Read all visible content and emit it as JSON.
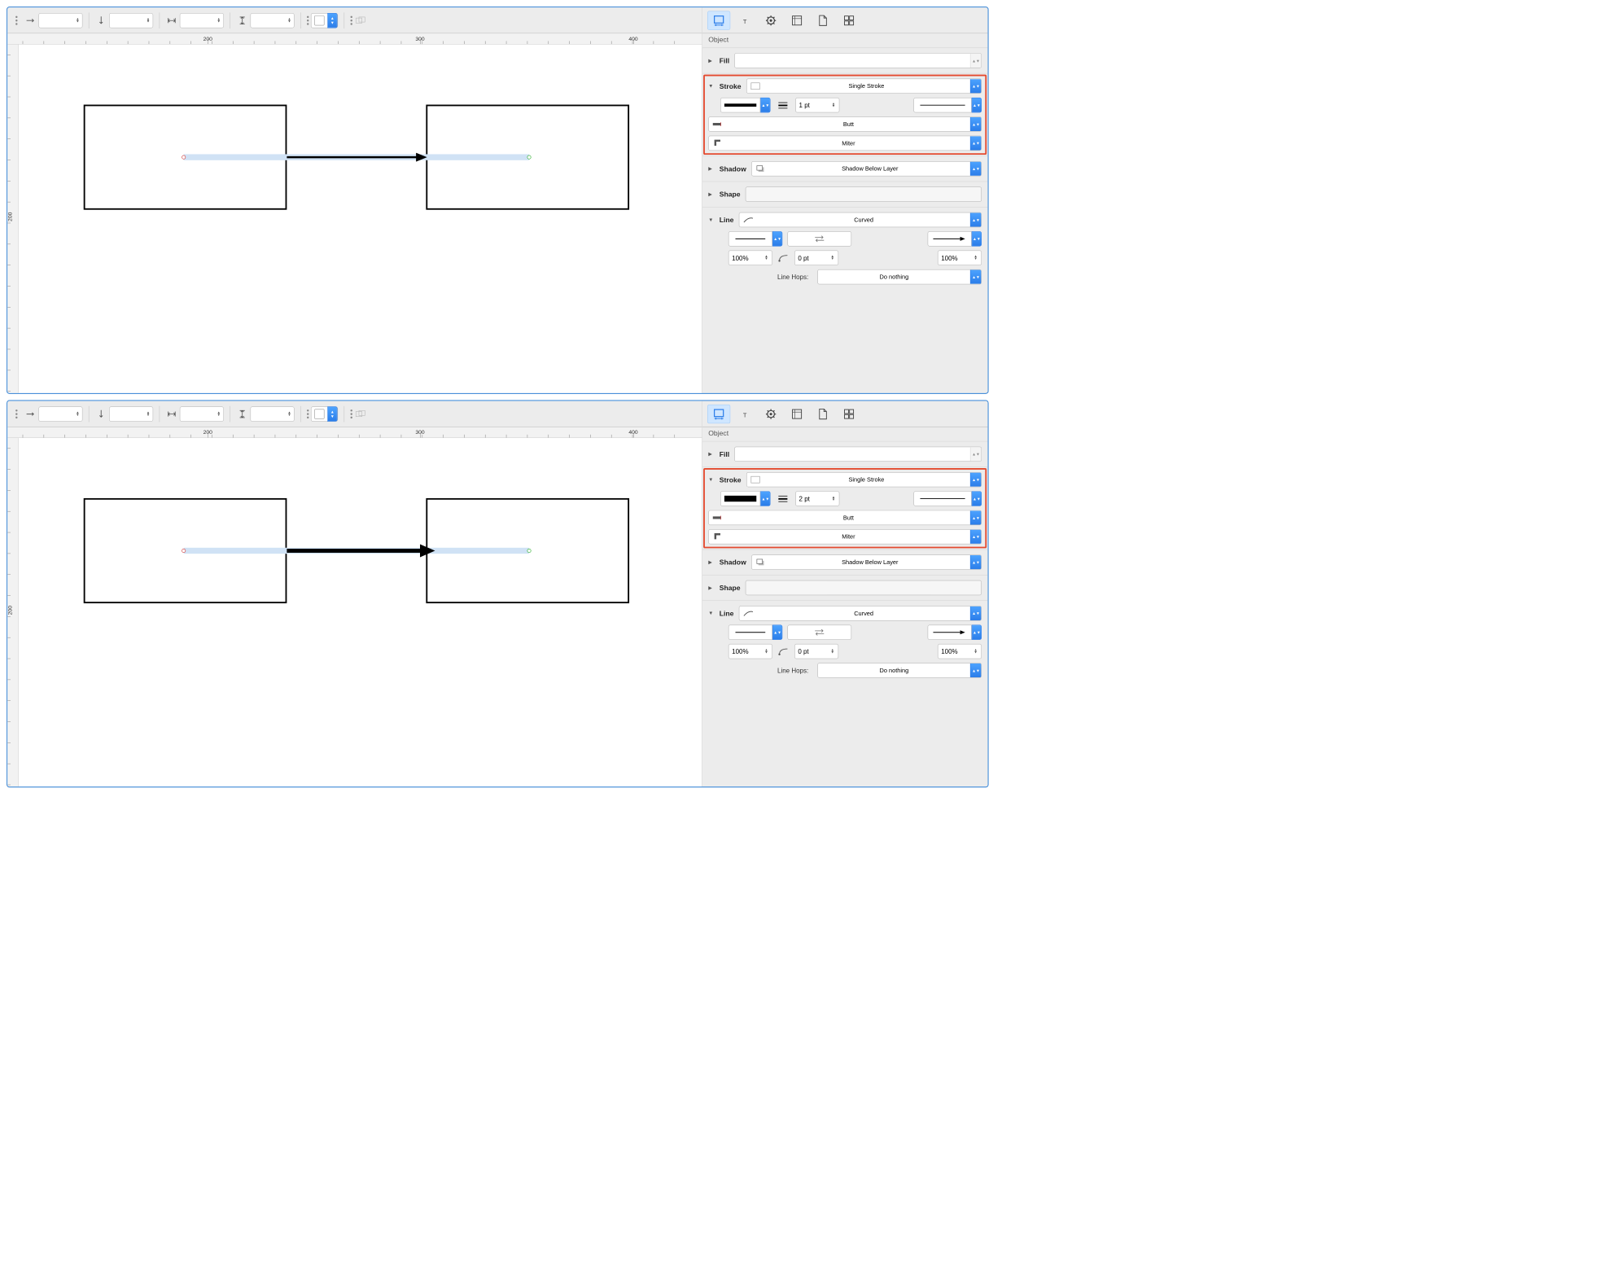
{
  "sidebar": {
    "title": "Object",
    "sections": {
      "fill": {
        "label": "Fill"
      },
      "stroke": {
        "label": "Stroke",
        "type": "Single Stroke",
        "cap": "Butt",
        "join": "Miter"
      },
      "shadow": {
        "label": "Shadow",
        "value": "Shadow Below Layer"
      },
      "shape": {
        "label": "Shape"
      },
      "line": {
        "label": "Line",
        "type": "Curved",
        "startPct": "100%",
        "bezier": "0 pt",
        "endPct": "100%",
        "hopsLabel": "Line Hops:",
        "hopsValue": "Do nothing"
      }
    }
  },
  "panels": [
    {
      "strokeWidth": "1 pt",
      "arrowThickness": 4
    },
    {
      "strokeWidth": "2 pt",
      "arrowThickness": 8
    }
  ],
  "ruler": {
    "hMarks": [
      "200",
      "300",
      "400"
    ],
    "vMark": "200"
  }
}
